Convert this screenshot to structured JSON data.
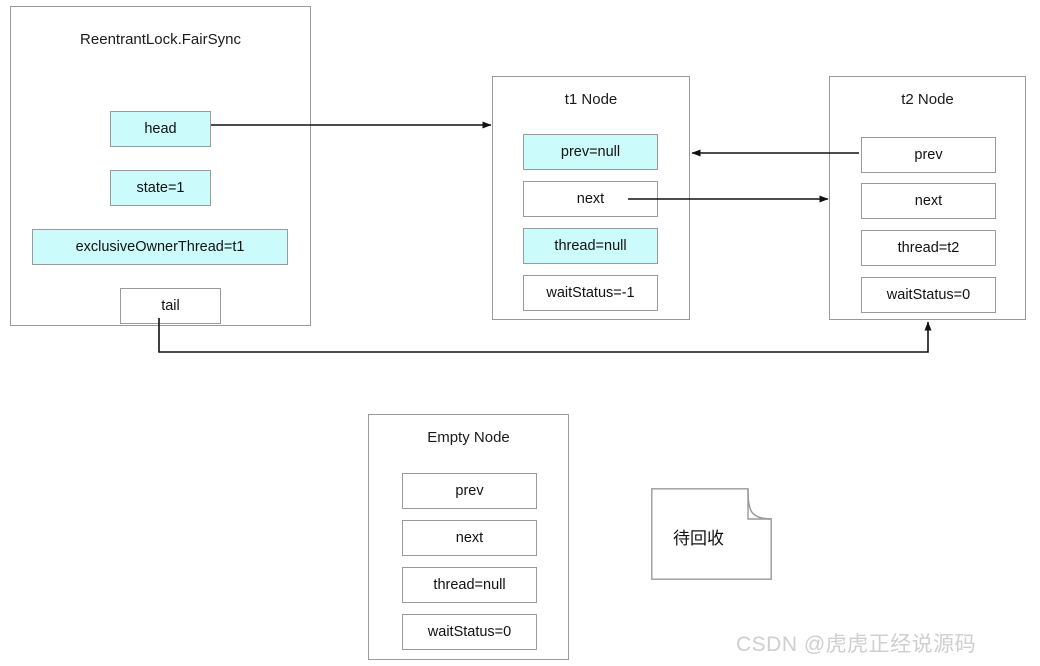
{
  "diagram": {
    "title_text": "ReentrantLock.FairSync AQS queue diagram",
    "colors": {
      "highlight_fill": "#ccfbfb",
      "box_border": "#9a9a9a",
      "edge_stroke": "#111111",
      "watermark": "#cfcfcf",
      "background": "#ffffff"
    },
    "groups": [
      {
        "id": "fairsync",
        "name": "fairsync-group",
        "title": "ReentrantLock.FairSync",
        "fields": [
          {
            "name": "head",
            "label": "head",
            "highlight": true
          },
          {
            "name": "state",
            "label": "state=1",
            "highlight": true
          },
          {
            "name": "exclusive-owner-thread",
            "label": "exclusiveOwnerThread=t1",
            "highlight": true
          },
          {
            "name": "tail",
            "label": "tail",
            "highlight": false
          }
        ]
      },
      {
        "id": "t1node",
        "name": "t1-node-group",
        "title": "t1 Node",
        "fields": [
          {
            "name": "prev",
            "label": "prev=null",
            "highlight": true
          },
          {
            "name": "next",
            "label": "next",
            "highlight": false
          },
          {
            "name": "thread",
            "label": "thread=null",
            "highlight": true
          },
          {
            "name": "wait-status",
            "label": "waitStatus=-1",
            "highlight": false
          }
        ]
      },
      {
        "id": "t2node",
        "name": "t2-node-group",
        "title": "t2 Node",
        "fields": [
          {
            "name": "prev",
            "label": "prev",
            "highlight": false
          },
          {
            "name": "next",
            "label": "next",
            "highlight": false
          },
          {
            "name": "thread",
            "label": "thread=t2",
            "highlight": false
          },
          {
            "name": "wait-status",
            "label": "waitStatus=0",
            "highlight": false
          }
        ]
      },
      {
        "id": "emptynode",
        "name": "empty-node-group",
        "title": "Empty Node",
        "fields": [
          {
            "name": "prev",
            "label": "prev",
            "highlight": false
          },
          {
            "name": "next",
            "label": "next",
            "highlight": false
          },
          {
            "name": "thread",
            "label": "thread=null",
            "highlight": false
          },
          {
            "name": "wait-status",
            "label": "waitStatus=0",
            "highlight": false
          }
        ]
      }
    ],
    "document_note": {
      "name": "recycle-note",
      "label": "待回收"
    },
    "watermark": {
      "name": "csdn-watermark",
      "label": "CSDN @虎虎正经说源码"
    },
    "edges": [
      {
        "name": "head-to-t1node",
        "from": "fairsync.head",
        "to": "t1node",
        "arrow": "end"
      },
      {
        "name": "t1node-next-to-t2node",
        "from": "t1node.next",
        "to": "t2node",
        "arrow": "end"
      },
      {
        "name": "t2node-prev-to-t1node",
        "from": "t2node.prev",
        "to": "t1node",
        "arrow": "end"
      },
      {
        "name": "tail-to-t2node",
        "from": "fairsync.tail",
        "to": "t2node",
        "arrow": "end"
      }
    ]
  }
}
